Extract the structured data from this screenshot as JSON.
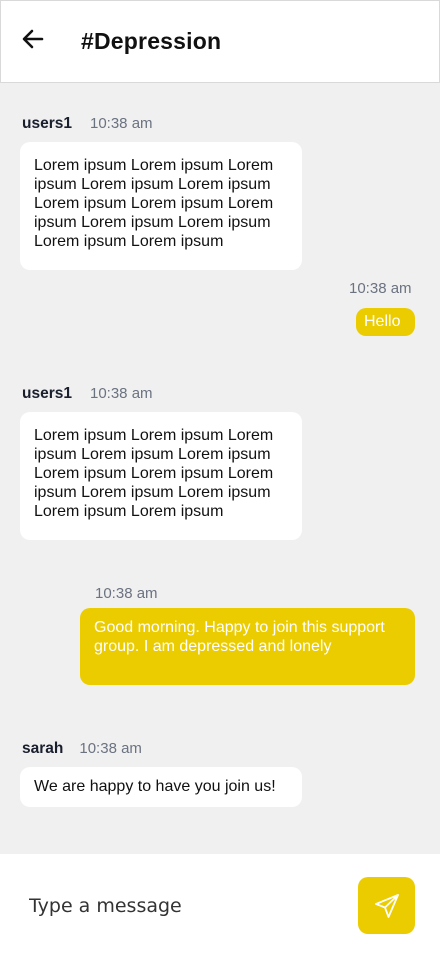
{
  "header": {
    "title": "#Depression",
    "back_icon": "arrow-left-icon"
  },
  "messages": [
    {
      "sender": "users1",
      "time": "10:38 am",
      "text": "Lorem ipsum Lorem ipsum Lorem ipsum Lorem ipsum Lorem ipsum Lorem ipsum Lorem ipsum Lorem ipsum Lorem ipsum Lorem ipsum Lorem ipsum Lorem ipsum",
      "direction": "incoming"
    },
    {
      "sender": "",
      "time": "10:38 am",
      "text": "Hello",
      "direction": "outgoing"
    },
    {
      "sender": "users1",
      "time": "10:38 am",
      "text": "Lorem ipsum Lorem ipsum Lorem ipsum Lorem ipsum Lorem ipsum Lorem ipsum Lorem ipsum Lorem ipsum Lorem ipsum Lorem ipsum Lorem ipsum Lorem ipsum",
      "direction": "incoming"
    },
    {
      "sender": "",
      "time": "10:38 am",
      "text": "Good morning. Happy to join this support group. I am depressed and lonely",
      "direction": "outgoing"
    },
    {
      "sender": "sarah",
      "time": "10:38 am",
      "text": "We are happy to have you join us!",
      "direction": "incoming"
    }
  ],
  "composer": {
    "placeholder": "Type a message",
    "send_icon": "send-icon"
  },
  "colors": {
    "accent": "#ebcc00",
    "background": "#f0f0f0",
    "bubble_in": "#ffffff"
  }
}
